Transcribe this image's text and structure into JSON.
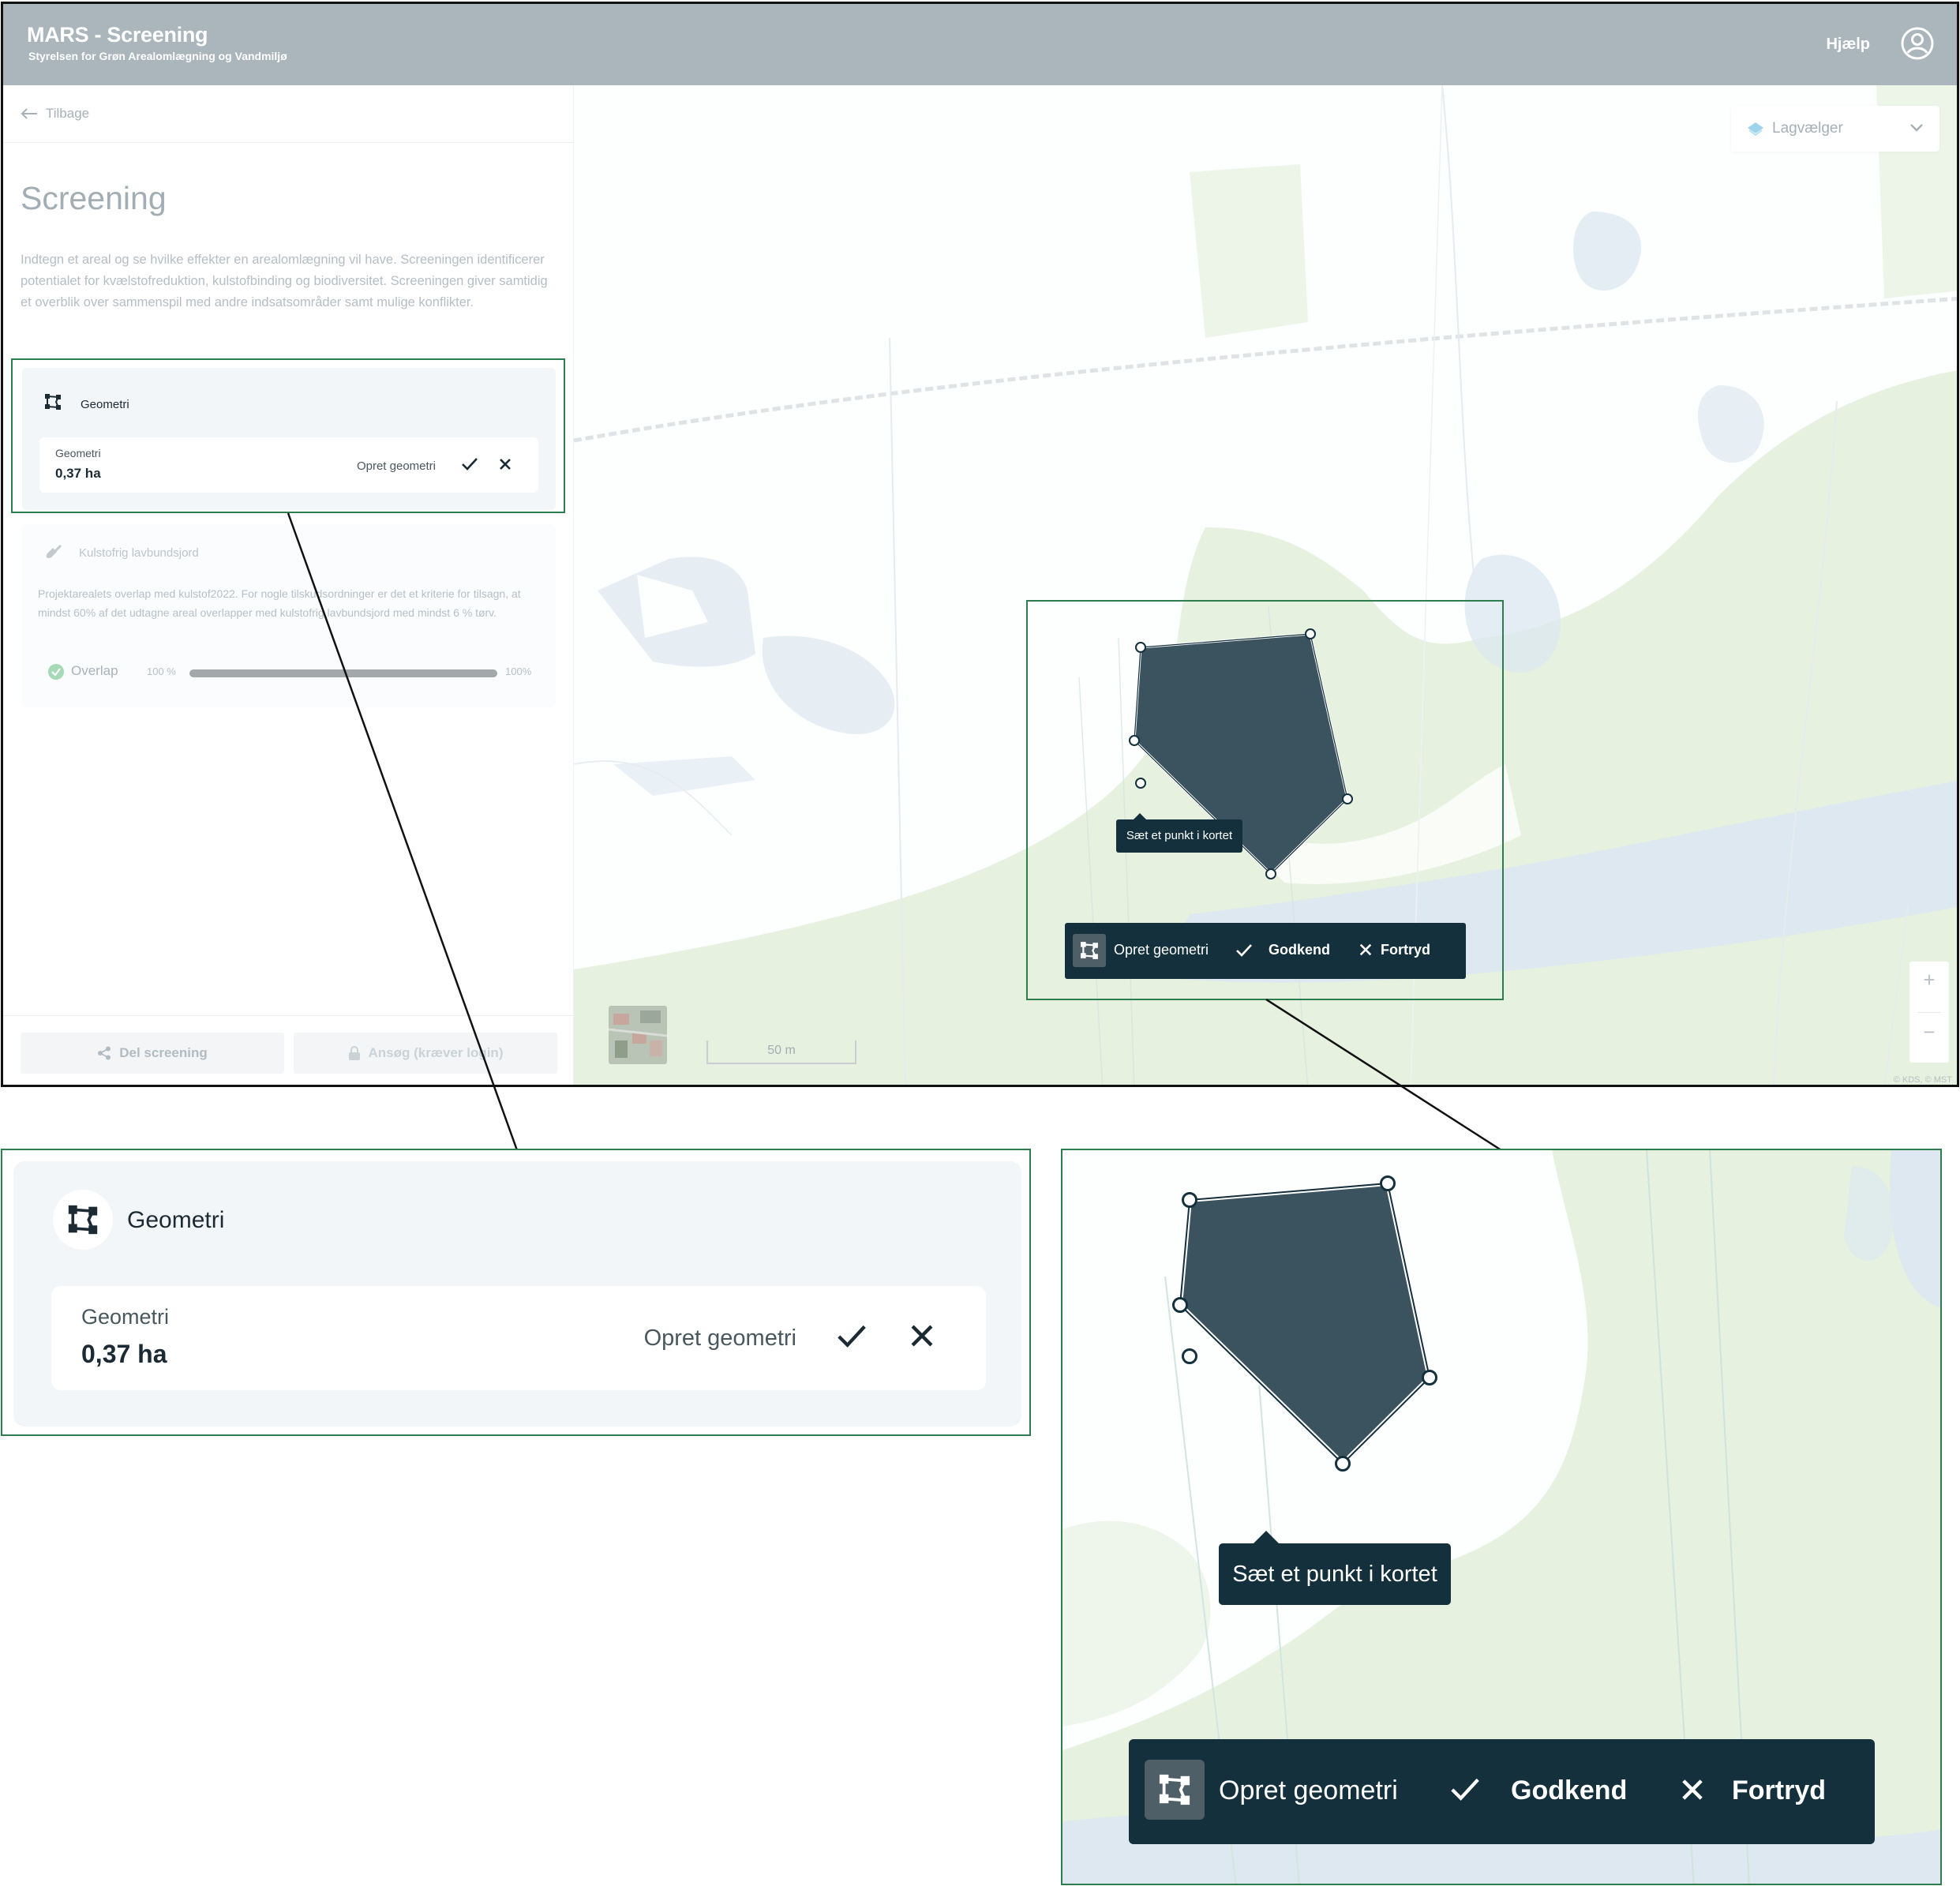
{
  "header": {
    "title": "MARS - Screening",
    "subtitle": "Styrelsen for Grøn Arealomlægning og Vandmiljø",
    "help_label": "Hjælp",
    "user_icon": "user-circle-icon",
    "background_color": "#aab5bc"
  },
  "sidebar": {
    "back_label": "Tilbage",
    "page_title": "Screening",
    "intro_text": "Indtegn et areal og se hvilke effekter en arealomlægning vil have. Screeningen identificerer potentialet for kvælstofreduktion, kulstofbinding og biodiversitet. Screeningen giver samtidig et overblik over sammenspil med andre indsatsområder samt mulige konflikter.",
    "geometry_card": {
      "title": "Geometri",
      "icon": "polygon-icon",
      "field_label": "Geometri",
      "field_value": "0,37 ha",
      "create_label": "Opret geometri"
    },
    "carbon_card": {
      "title": "Kulstofrig lavbundsjord",
      "icon": "shovel-icon",
      "description": "Projektarealets overlap med kulstof2022. For nogle tilskudsordninger er det et kriterie for tilsagn, at mindst 60% af det udtagne areal overlapper med kulstofrig lavbundsjord med mindst 6 % tørv.",
      "overlap_label": "Overlap",
      "overlap_value_left": "100 %",
      "overlap_value_right": "100%",
      "overlap_fraction": 1.0
    },
    "share_label": "Del screening",
    "apply_label": "Ansøg (kræver login)"
  },
  "map": {
    "layer_picker_label": "Lagvælger",
    "scale_label": "50 m",
    "zoom_in": "+",
    "zoom_out": "−",
    "attribution": "© KDS, © MST",
    "tooltip": "Sæt et punkt i kortet",
    "draw_toolbar": {
      "create_label": "Opret geometri",
      "approve_label": "Godkend",
      "cancel_label": "Fortryd"
    },
    "polygon_color": "#3b535e"
  },
  "zoom_geometry": {
    "title": "Geometri",
    "field_label": "Geometri",
    "field_value": "0,37 ha",
    "create_label": "Opret geometri"
  },
  "zoom_map": {
    "tooltip": "Sæt et punkt i kortet",
    "create_label": "Opret geometri",
    "approve_label": "Godkend",
    "cancel_label": "Fortryd"
  },
  "colors": {
    "highlight_frame": "#2e7d4f",
    "toolbar_bg": "#13303c",
    "map_green": "#e6f1df",
    "map_water": "#dde8f0"
  }
}
